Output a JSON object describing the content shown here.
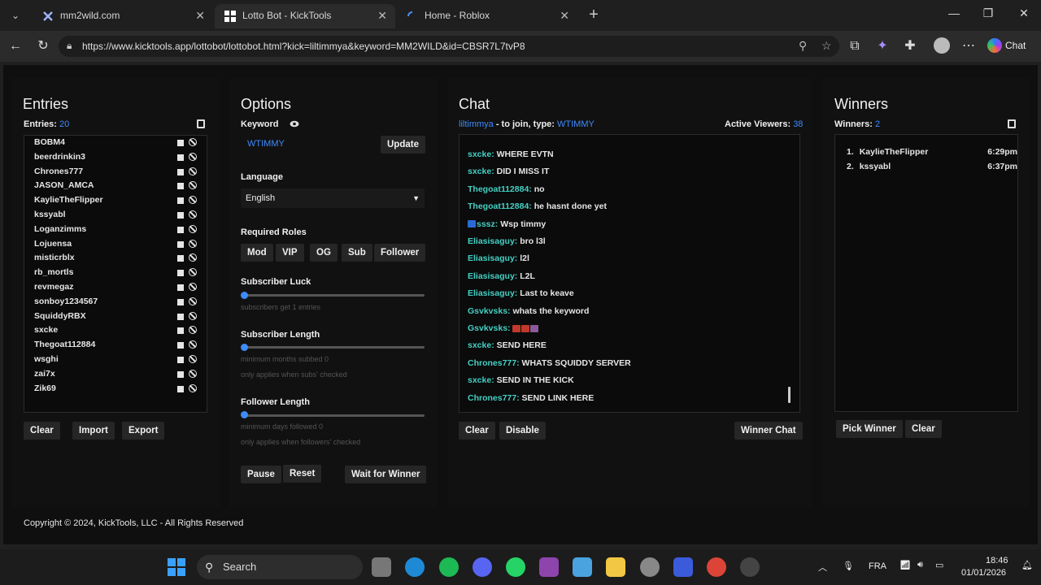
{
  "browser": {
    "tabs": [
      {
        "title": "mm2wild.com",
        "close": "✕"
      },
      {
        "title": "Lotto Bot - KickTools",
        "close": "✕"
      },
      {
        "title": "Home - Roblox",
        "close": "✕"
      }
    ],
    "newtab": "+",
    "url": "https://www.kicktools.app/lottobot/lottobot.html?kick=liltimmya&keyword=MM2WILD&id=CBSR7L7tvP8",
    "chat_label": "Chat"
  },
  "entries": {
    "title": "Entries",
    "count_label": "Entries:",
    "count": "20",
    "list": [
      "BOBM4",
      "beerdrinkin3",
      "Chrones777",
      "JASON_AMCA",
      "KaylieTheFlipper",
      "kssyabl",
      "Loganzimms",
      "Lojuensa",
      "misticrblx",
      "rb_mortls",
      "revmegaz",
      "sonboy1234567",
      "SquiddyRBX",
      "sxcke",
      "Thegoat112884",
      "wsghi",
      "zai7x",
      "Zik69"
    ],
    "buttons": {
      "clear": "Clear",
      "import": "Import",
      "export": "Export"
    }
  },
  "options": {
    "title": "Options",
    "keyword_label": "Keyword",
    "keyword_value": "WTIMMY",
    "update": "Update",
    "language_label": "Language",
    "language_value": "English",
    "roles_label": "Required Roles",
    "roles": [
      "Mod",
      "VIP",
      "OG",
      "Sub",
      "Follower"
    ],
    "sub_luck": {
      "label": "Subscriber Luck",
      "hint": "subscribers get 1 entries",
      "value": 0
    },
    "sub_length": {
      "label": "Subscriber Length",
      "hint1": "minimum months subbed 0",
      "hint2": "only applies when subs' checked",
      "value": 0
    },
    "follower_length": {
      "label": "Follower Length",
      "hint1": "minimum days followed 0",
      "hint2": "only applies when followers' checked",
      "value": 0
    },
    "buttons": {
      "pause": "Pause",
      "reset": "Reset",
      "wait": "Wait for Winner"
    }
  },
  "chat": {
    "title": "Chat",
    "streamer": "liltimmya",
    "join_text": " - to join, type: ",
    "keyword": "WTIMMY",
    "viewers_label": "Active Viewers:",
    "viewers": "38",
    "messages": [
      {
        "user": "sxcke:",
        "text": "WHERE EVTN"
      },
      {
        "user": "sxcke:",
        "text": "DID I MISS IT"
      },
      {
        "user": "Thegoat112884:",
        "text": "no"
      },
      {
        "user": "Thegoat112884:",
        "text": "he hasnt done yet"
      },
      {
        "user": "sssz:",
        "text": "Wsp timmy"
      },
      {
        "user": "Eliasisaguy:",
        "text": "bro l3l"
      },
      {
        "user": "Eliasisaguy:",
        "text": "l2l"
      },
      {
        "user": "Eliasisaguy:",
        "text": "L2L"
      },
      {
        "user": "Eliasisaguy:",
        "text": "Last to keave"
      },
      {
        "user": "Gsvkvsks:",
        "text": "whats the keyword"
      },
      {
        "user": "Gsvkvsks:",
        "text": ""
      },
      {
        "user": "sxcke:",
        "text": "SEND HERE"
      },
      {
        "user": "Chrones777:",
        "text": "WHATS SQUIDDY SERVER"
      },
      {
        "user": "sxcke:",
        "text": "SEND IN THE KICK"
      },
      {
        "user": "Chrones777:",
        "text": "SEND LINK HERE"
      }
    ],
    "buttons": {
      "clear": "Clear",
      "disable": "Disable",
      "winner_chat": "Winner Chat"
    }
  },
  "winners": {
    "title": "Winners",
    "count_label": "Winners:",
    "count": "2",
    "list": [
      {
        "num": "1.",
        "name": "KaylieTheFlipper",
        "time": "6:29pm"
      },
      {
        "num": "2.",
        "name": "kssyabl",
        "time": "6:37pm"
      }
    ],
    "buttons": {
      "pick": "Pick Winner",
      "clear": "Clear"
    }
  },
  "footer": "Copyright © 2024, KickTools, LLC - All Rights Reserved",
  "taskbar": {
    "search": "Search",
    "lang": "FRA",
    "time": "18:46",
    "date": "01/01/2026"
  },
  "colors": {
    "accent": "#3d8bfd",
    "chat_user": "#45d0c4",
    "panel": "#111111"
  }
}
